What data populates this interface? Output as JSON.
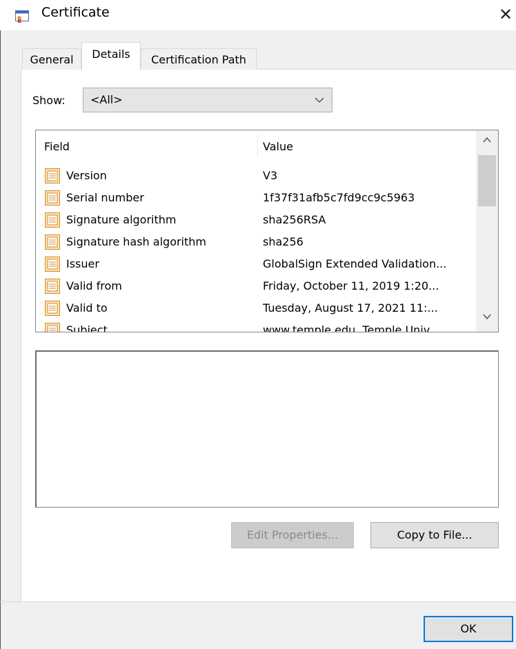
{
  "window": {
    "title": "Certificate",
    "close_glyph": "✕"
  },
  "tabs": [
    {
      "label": "General"
    },
    {
      "label": "Details"
    },
    {
      "label": "Certification Path"
    }
  ],
  "show": {
    "label": "Show:",
    "value": "<All>"
  },
  "list": {
    "columns": {
      "field": "Field",
      "value": "Value"
    },
    "rows": [
      {
        "field": "Version",
        "value": "V3"
      },
      {
        "field": "Serial number",
        "value": "1f37f31afb5c7fd9cc9c5963"
      },
      {
        "field": "Signature algorithm",
        "value": "sha256RSA"
      },
      {
        "field": "Signature hash algorithm",
        "value": "sha256"
      },
      {
        "field": "Issuer",
        "value": "GlobalSign Extended Validation..."
      },
      {
        "field": "Valid from",
        "value": "Friday, October 11, 2019 1:20..."
      },
      {
        "field": "Valid to",
        "value": "Tuesday, August 17, 2021 11:..."
      },
      {
        "field": "Subject",
        "value": "www.temple.edu, Temple Univ..."
      }
    ]
  },
  "buttons": {
    "edit_properties": "Edit Properties...",
    "copy_to_file": "Copy to File...",
    "ok": "OK"
  },
  "colors": {
    "accent": "#0078d7",
    "field_icon": "#e8a030",
    "window_bg": "#f0f0f0"
  }
}
